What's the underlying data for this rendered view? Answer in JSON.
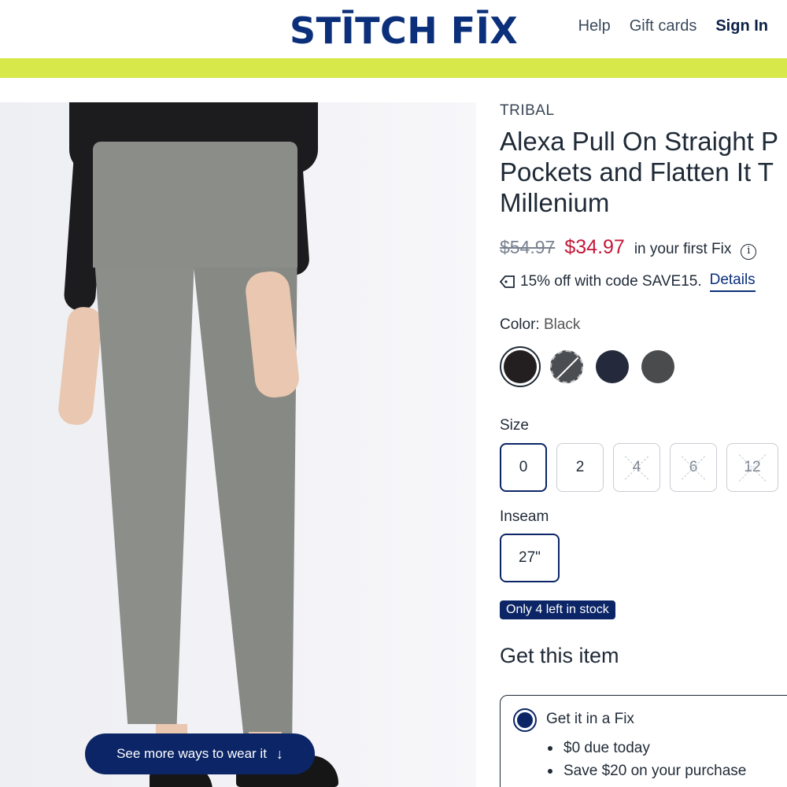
{
  "header": {
    "logo": "STĪTCH FĪX",
    "nav": {
      "help": "Help",
      "gift_cards": "Gift cards",
      "sign_in": "Sign In"
    }
  },
  "product": {
    "brand": "TRIBAL",
    "title_lines": [
      "Alexa Pull On Straight P",
      "Pockets and Flatten It T",
      "Millenium"
    ],
    "old_price": "$54.97",
    "new_price": "$34.97",
    "price_note": "in your first Fix",
    "promo_text": "15% off with code SAVE15.",
    "promo_link": "Details",
    "color_label": "Color:",
    "color_value": "Black",
    "size_label": "Size",
    "sizes": [
      {
        "label": "0",
        "state": "selected"
      },
      {
        "label": "2",
        "state": "available"
      },
      {
        "label": "4",
        "state": "unavailable"
      },
      {
        "label": "6",
        "state": "unavailable"
      },
      {
        "label": "12",
        "state": "unavailable"
      }
    ],
    "inseam_label": "Inseam",
    "inseam_value": "27\"",
    "stock_badge": "Only 4 left in stock"
  },
  "purchase": {
    "title": "Get this item",
    "option": {
      "title": "Get it in a Fix",
      "bullets": [
        "$0 due today",
        "Save $20 on your purchase"
      ]
    }
  },
  "image_overlay": {
    "wear_button": "See more ways to wear it",
    "wear_icon": "↓"
  },
  "colors": {
    "brand_navy": "#0b2566",
    "sale_red": "#c4183a",
    "promo_bar": "#d6e84a"
  }
}
